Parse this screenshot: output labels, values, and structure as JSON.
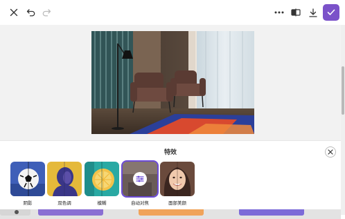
{
  "toolbar": {
    "close": "close-icon",
    "undo": "undo-icon",
    "redo": "redo-icon",
    "more": "more-icon",
    "compare": "compare-icon",
    "download": "download-icon",
    "done": "check-icon",
    "accent": "#7b52c9"
  },
  "effects": {
    "title": "特效",
    "close": "close-icon",
    "items": [
      {
        "label": "阴影",
        "icon": "soccer-ball-icon",
        "selected": false
      },
      {
        "label": "双色调",
        "icon": "portrait-icon",
        "selected": false
      },
      {
        "label": "模糊",
        "icon": "lemon-icon",
        "selected": false
      },
      {
        "label": "自动对焦",
        "icon": "adjust-icon",
        "selected": true
      },
      {
        "label": "面部美颜",
        "icon": "face-icon",
        "selected": false
      }
    ],
    "selected_color": "#6b4ad6"
  }
}
